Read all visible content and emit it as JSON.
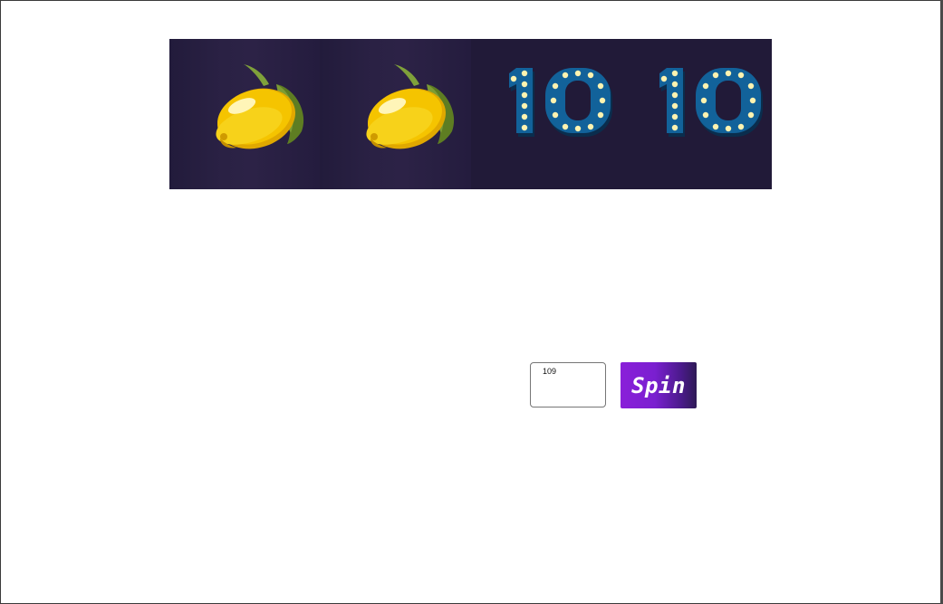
{
  "reels": {
    "symbols": [
      {
        "name": "lemon-symbol",
        "kind": "lemon"
      },
      {
        "name": "lemon-symbol",
        "kind": "lemon"
      },
      {
        "name": "ten-symbol",
        "kind": "ten",
        "label": "10"
      },
      {
        "name": "ten-symbol",
        "kind": "ten",
        "label": "10"
      }
    ],
    "background_color": "#221a3a"
  },
  "controls": {
    "bet_value": "109",
    "spin_label": "Spin",
    "spin_color": "#8a1fd9"
  },
  "colors": {
    "lemon_yellow": "#f5c400",
    "leaf_green": "#6f8f2a",
    "ten_blue": "#0f5a8e",
    "bulb": "#fff3b0"
  }
}
